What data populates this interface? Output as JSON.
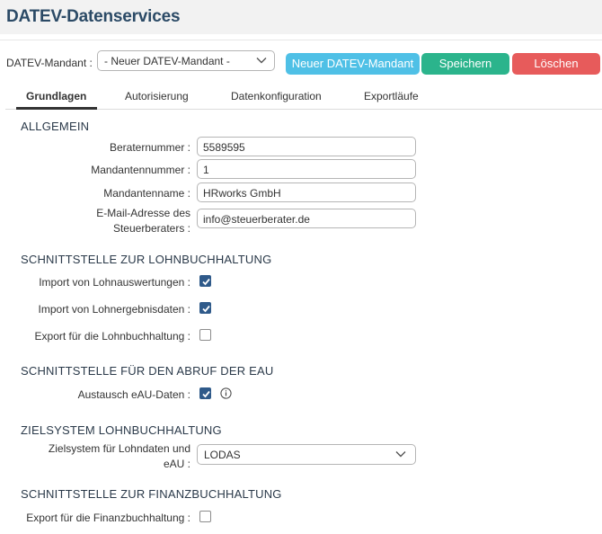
{
  "header": {
    "title": "DATEV-Datenservices"
  },
  "toolbar": {
    "mandant_label": "DATEV-Mandant :",
    "mandant_selected": "- Neuer DATEV-Mandant -",
    "new_label": "Neuer DATEV-Mandant",
    "save_label": "Speichern",
    "delete_label": "Löschen"
  },
  "tabs": [
    {
      "label": "Grundlagen",
      "active": true
    },
    {
      "label": "Autorisierung",
      "active": false
    },
    {
      "label": "Datenkonfiguration",
      "active": false
    },
    {
      "label": "Exportläufe",
      "active": false
    }
  ],
  "allgemein": {
    "heading": "ALLGEMEIN",
    "berater_label": "Beraternummer :",
    "berater_value": "5589595",
    "mandantennummer_label": "Mandantennummer :",
    "mandantennummer_value": "1",
    "mandantenname_label": "Mandantenname :",
    "mandantenname_value": "HRworks GmbH",
    "email_label_line1": "E-Mail-Adresse des",
    "email_label_line2": "Steuerberaters :",
    "email_value": "info@steuerberater.de"
  },
  "lohn": {
    "heading": "SCHNITTSTELLE ZUR LOHNBUCHHALTUNG",
    "import_auswertungen_label": "Import von Lohnauswertungen :",
    "import_auswertungen_checked": true,
    "import_ergebnisse_label": "Import von Lohnergebnisdaten :",
    "import_ergebnisse_checked": true,
    "export_label": "Export für die Lohnbuchhaltung :",
    "export_checked": false
  },
  "eau": {
    "heading": "SCHNITTSTELLE FÜR DEN ABRUF DER EAU",
    "austausch_label": "Austausch eAU-Daten :",
    "austausch_checked": true
  },
  "zielsystem": {
    "heading": "ZIELSYSTEM LOHNBUCHHALTUNG",
    "label_line1": "Zielsystem für Lohndaten und",
    "label_line2": "eAU :",
    "selected": "LODAS"
  },
  "finanz": {
    "heading": "SCHNITTSTELLE ZUR FINANZBUCHHALTUNG",
    "export_label": "Export für die Finanzbuchhaltung :",
    "export_checked": false
  }
}
